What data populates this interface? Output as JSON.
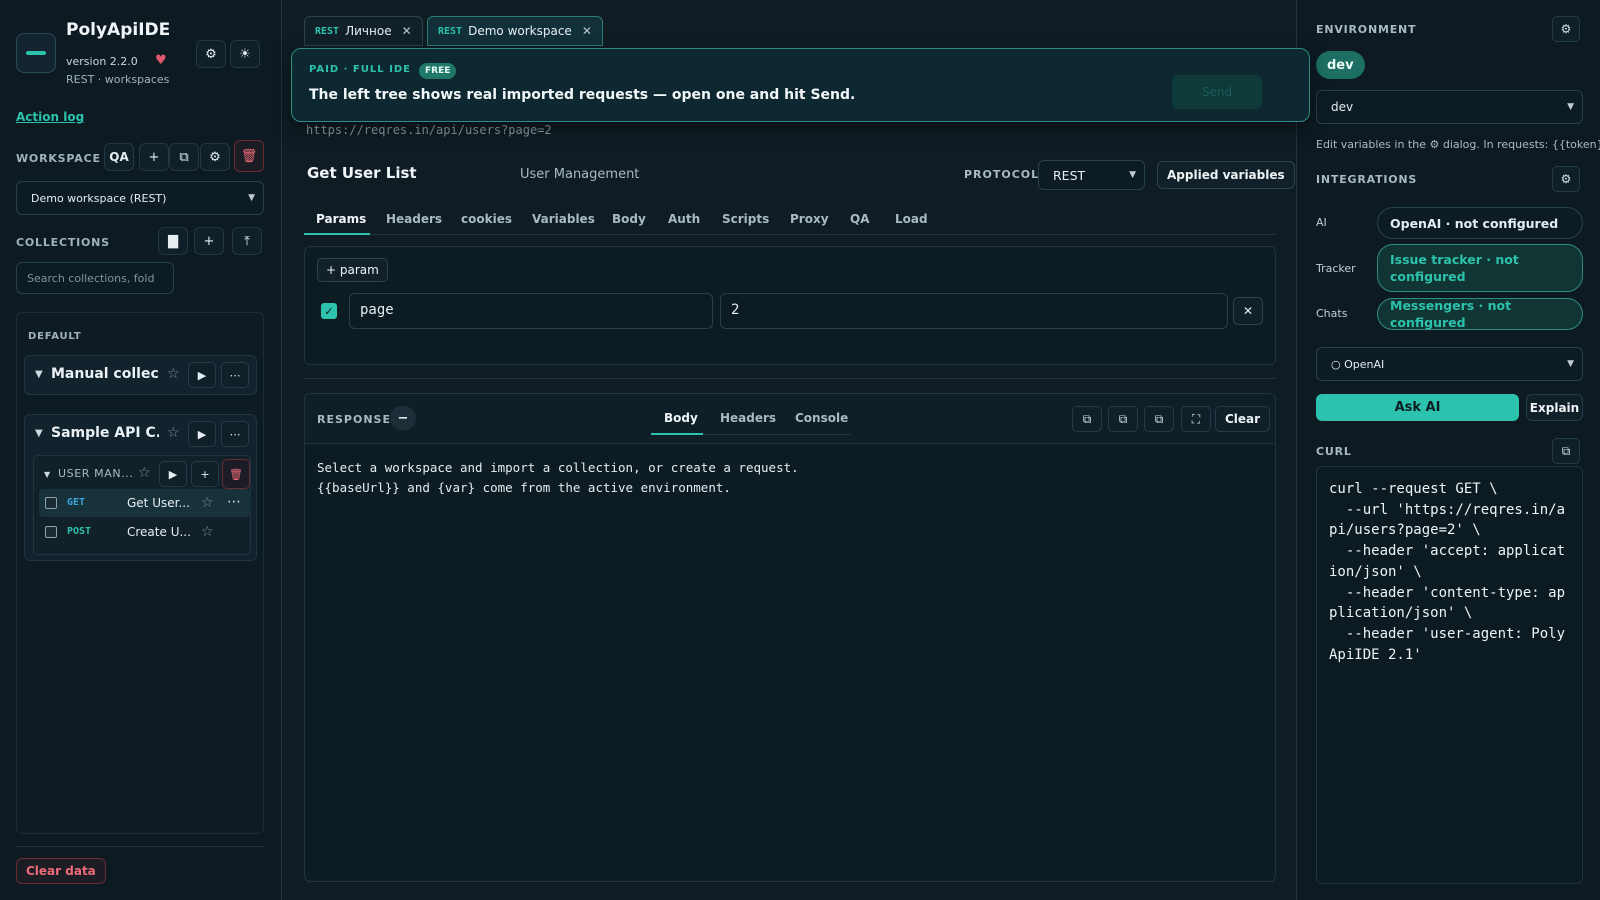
{
  "app": {
    "name": "PolyApiIDE",
    "version": "version 2.2.0",
    "subtitle": "REST · workspaces",
    "action_log": "Action log",
    "clear_data": "Clear data"
  },
  "workspace": {
    "label": "WORKSPACE",
    "qa_label": "QA",
    "selected": "Demo workspace (REST)"
  },
  "collections": {
    "label": "COLLECTIONS",
    "search_placeholder": "Search collections, fold",
    "default_label": "DEFAULT",
    "items": [
      {
        "name": "Manual collec..."
      },
      {
        "name": "Sample API C...",
        "folder": "USER MAN...",
        "requests": [
          {
            "method": "GET",
            "name": "Get User...",
            "method_color": "#3aa6d8"
          },
          {
            "method": "POST",
            "name": "Create U...",
            "method_color": "#2cc2ad"
          }
        ]
      }
    ]
  },
  "tabs": [
    {
      "proto": "REST",
      "name": "Личное"
    },
    {
      "proto": "REST",
      "name": "Demo workspace"
    }
  ],
  "banner": {
    "tag": "PAID · FULL IDE",
    "badge": "FREE",
    "message": "The left tree shows real imported requests — open one and hit Send.",
    "send_label": "Send"
  },
  "request": {
    "url": "https://reqres.in/api/users?page=2",
    "title": "Get User List",
    "collection": "User Management",
    "protocol_label": "PROTOCOL",
    "protocol": "REST",
    "applied_variables": "Applied variables",
    "subtabs": [
      "Params",
      "Headers",
      "cookies",
      "Variables",
      "Body",
      "Auth",
      "Scripts",
      "Proxy",
      "QA",
      "Load"
    ],
    "add_param": "+ param",
    "param": {
      "key": "page",
      "value": "2"
    }
  },
  "response": {
    "label": "RESPONSE",
    "tabs": [
      "Body",
      "Headers",
      "Console"
    ],
    "clear": "Clear",
    "body": "Select a workspace and import a collection, or create a request.\n{{baseUrl}} and {var} come from the active environment."
  },
  "environment": {
    "label": "ENVIRONMENT",
    "active": "dev",
    "selected": "dev",
    "hint": "Edit variables in the ⚙ dialog. In requests: {{token}}."
  },
  "integrations": {
    "label": "INTEGRATIONS",
    "items": [
      {
        "label": "AI",
        "value": "OpenAI · not configured"
      },
      {
        "label": "Tracker",
        "value": "Issue tracker · not configured"
      },
      {
        "label": "Chats",
        "value": "Messengers · not configured"
      }
    ],
    "ai_select": "○ OpenAI",
    "ask_ai": "Ask AI",
    "explain": "Explain"
  },
  "curl": {
    "label": "CURL",
    "text": "curl --request GET \\\n  --url 'https://reqres.in/api/users?page=2' \\\n  --header 'accept: application/json' \\\n  --header 'content-type: application/json' \\\n  --header 'user-agent: PolyApiIDE 2.1'"
  },
  "colors": {
    "accent": "#2cc2ad",
    "danger": "#ee6b79",
    "background": "#0f1c24"
  }
}
